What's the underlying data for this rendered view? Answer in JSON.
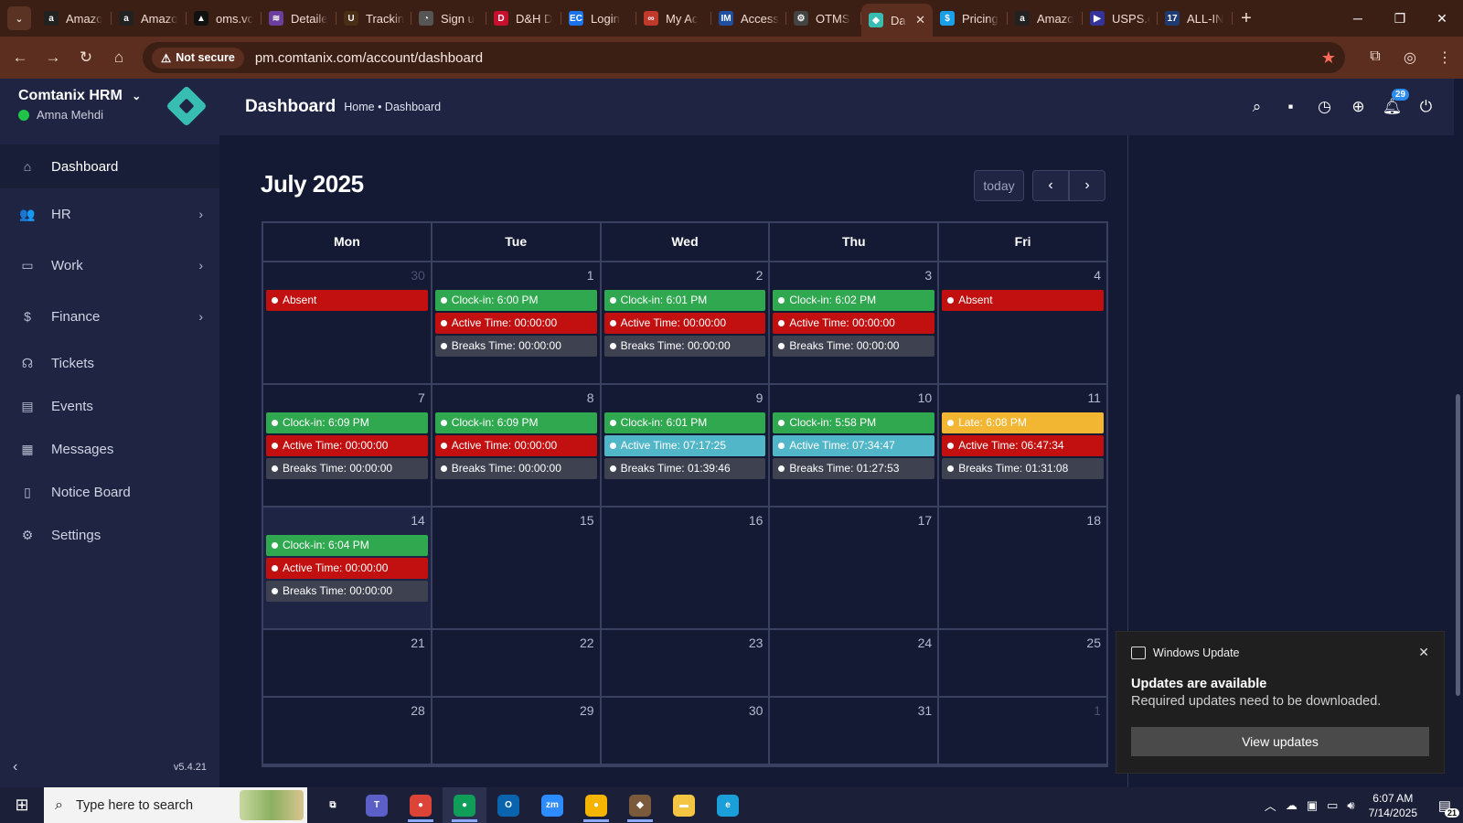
{
  "browser": {
    "tabs": [
      {
        "label": "Amazo",
        "fav": "a",
        "color": "#222222"
      },
      {
        "label": "Amazo",
        "fav": "a",
        "color": "#222222"
      },
      {
        "label": "oms.vc",
        "fav": "▲",
        "color": "#111111"
      },
      {
        "label": "Detaile",
        "fav": "≋",
        "color": "#6b3f9e"
      },
      {
        "label": "Trackin",
        "fav": "U",
        "color": "#4b2e16"
      },
      {
        "label": "Sign u",
        "fav": "◔",
        "color": "#555555"
      },
      {
        "label": "D&H D",
        "fav": "D",
        "color": "#c8102e"
      },
      {
        "label": "Login",
        "fav": "EC",
        "color": "#1a73e8"
      },
      {
        "label": "My Ac",
        "fav": "∞",
        "color": "#c0392b"
      },
      {
        "label": "Access",
        "fav": "IM",
        "color": "#1e4fa3"
      },
      {
        "label": "OTMS",
        "fav": "⚙",
        "color": "#444444"
      },
      {
        "label": "Da",
        "fav": "◆",
        "color": "#38bdb2",
        "active": true
      },
      {
        "label": "Pricing",
        "fav": "$",
        "color": "#1aa0e8"
      },
      {
        "label": "Amazo",
        "fav": "a",
        "color": "#222222"
      },
      {
        "label": "USPS.c",
        "fav": "▶",
        "color": "#333399"
      },
      {
        "label": "ALL-IN",
        "fav": "17",
        "color": "#1e3c72"
      }
    ],
    "close_tab": "✕",
    "new_tab": "+",
    "not_secure": "Not secure",
    "url": "pm.comtanix.com/account/dashboard"
  },
  "sidebar": {
    "org": "Comtanix HRM",
    "user": "Amna Mehdi",
    "items": [
      {
        "label": "Dashboard",
        "icon": "home-icon",
        "glyph": "⌂",
        "active": true,
        "chevron": false
      },
      {
        "label": "HR",
        "icon": "users-icon",
        "glyph": "👥",
        "chevron": true
      },
      {
        "label": "Work",
        "icon": "briefcase-icon",
        "glyph": "▭",
        "chevron": true
      },
      {
        "label": "Finance",
        "icon": "dollar-icon",
        "glyph": "$",
        "chevron": true
      },
      {
        "label": "Tickets",
        "icon": "headset-icon",
        "glyph": "☊",
        "chevron": false
      },
      {
        "label": "Events",
        "icon": "calendar-icon",
        "glyph": "▤",
        "chevron": false
      },
      {
        "label": "Messages",
        "icon": "message-icon",
        "glyph": "▦",
        "chevron": false
      },
      {
        "label": "Notice Board",
        "icon": "clipboard-icon",
        "glyph": "▯",
        "chevron": false
      },
      {
        "label": "Settings",
        "icon": "gear-icon",
        "glyph": "⚙",
        "chevron": false
      }
    ],
    "version": "v5.4.21"
  },
  "header": {
    "title": "Dashboard",
    "breadcrumb": "Home • Dashboard",
    "notification_count": "29"
  },
  "calendar": {
    "month_title": "July 2025",
    "today_label": "today",
    "days": [
      "Mon",
      "Tue",
      "Wed",
      "Thu",
      "Fri"
    ],
    "weeks": [
      {
        "height": 134,
        "cells": [
          {
            "day": "30",
            "other": true,
            "events": [
              {
                "text": "Absent",
                "kind": "red"
              }
            ]
          },
          {
            "day": "1",
            "events": [
              {
                "text": "Clock-in: 6:00 PM",
                "kind": "green"
              },
              {
                "text": "Active Time: 00:00:00",
                "kind": "red"
              },
              {
                "text": "Breaks Time: 00:00:00",
                "kind": "gray"
              }
            ]
          },
          {
            "day": "2",
            "events": [
              {
                "text": "Clock-in: 6:01 PM",
                "kind": "green"
              },
              {
                "text": "Active Time: 00:00:00",
                "kind": "red"
              },
              {
                "text": "Breaks Time: 00:00:00",
                "kind": "gray"
              }
            ]
          },
          {
            "day": "3",
            "events": [
              {
                "text": "Clock-in: 6:02 PM",
                "kind": "green"
              },
              {
                "text": "Active Time: 00:00:00",
                "kind": "red"
              },
              {
                "text": "Breaks Time: 00:00:00",
                "kind": "gray"
              }
            ]
          },
          {
            "day": "4",
            "events": [
              {
                "text": "Absent",
                "kind": "red"
              }
            ]
          }
        ]
      },
      {
        "height": 134,
        "cells": [
          {
            "day": "7",
            "events": [
              {
                "text": "Clock-in: 6:09 PM",
                "kind": "green"
              },
              {
                "text": "Active Time: 00:00:00",
                "kind": "red"
              },
              {
                "text": "Breaks Time: 00:00:00",
                "kind": "gray"
              }
            ]
          },
          {
            "day": "8",
            "events": [
              {
                "text": "Clock-in: 6:09 PM",
                "kind": "green"
              },
              {
                "text": "Active Time: 00:00:00",
                "kind": "red"
              },
              {
                "text": "Breaks Time: 00:00:00",
                "kind": "gray"
              }
            ]
          },
          {
            "day": "9",
            "events": [
              {
                "text": "Clock-in: 6:01 PM",
                "kind": "green"
              },
              {
                "text": "Active Time: 07:17:25",
                "kind": "teal"
              },
              {
                "text": "Breaks Time: 01:39:46",
                "kind": "gray"
              }
            ]
          },
          {
            "day": "10",
            "events": [
              {
                "text": "Clock-in: 5:58 PM",
                "kind": "green"
              },
              {
                "text": "Active Time: 07:34:47",
                "kind": "teal"
              },
              {
                "text": "Breaks Time: 01:27:53",
                "kind": "gray"
              }
            ]
          },
          {
            "day": "11",
            "events": [
              {
                "text": "Late: 6:08 PM",
                "kind": "yellow"
              },
              {
                "text": "Active Time: 06:47:34",
                "kind": "red"
              },
              {
                "text": "Breaks Time: 01:31:08",
                "kind": "gray"
              }
            ]
          }
        ]
      },
      {
        "height": 134,
        "cells": [
          {
            "day": "14",
            "today": true,
            "events": [
              {
                "text": "Clock-in: 6:04 PM",
                "kind": "green"
              },
              {
                "text": "Active Time: 00:00:00",
                "kind": "red"
              },
              {
                "text": "Breaks Time: 00:00:00",
                "kind": "gray"
              }
            ]
          },
          {
            "day": "15",
            "events": []
          },
          {
            "day": "16",
            "events": []
          },
          {
            "day": "17",
            "events": []
          },
          {
            "day": "18",
            "events": []
          }
        ]
      },
      {
        "height": 74,
        "cells": [
          {
            "day": "21",
            "events": []
          },
          {
            "day": "22",
            "events": []
          },
          {
            "day": "23",
            "events": []
          },
          {
            "day": "24",
            "events": []
          },
          {
            "day": "25",
            "events": []
          }
        ]
      },
      {
        "height": 74,
        "cells": [
          {
            "day": "28",
            "events": []
          },
          {
            "day": "29",
            "events": []
          },
          {
            "day": "30",
            "events": []
          },
          {
            "day": "31",
            "events": []
          },
          {
            "day": "1",
            "other": true,
            "events": []
          }
        ]
      }
    ],
    "colors": {
      "green": "#2fa84f",
      "red": "#c20f0f",
      "gray": "#3e4150",
      "teal": "#51b6c7",
      "yellow": "#f3b632"
    }
  },
  "toast": {
    "app": "Windows Update",
    "title": "Updates are available",
    "body": "Required updates need to be downloaded.",
    "button": "View updates"
  },
  "taskbar": {
    "search_placeholder": "Type here to search",
    "time": "6:07 AM",
    "date": "7/14/2025",
    "notification_count": "21",
    "apps": [
      {
        "name": "task-view-icon",
        "glyph": "⧉",
        "bg": "transparent"
      },
      {
        "name": "teams-icon",
        "glyph": "T",
        "bg": "#5b5fc7"
      },
      {
        "name": "chrome-icon",
        "glyph": "●",
        "bg": "#db4437",
        "on": true
      },
      {
        "name": "chrome-profile-icon",
        "glyph": "●",
        "bg": "#0f9d58",
        "on": true,
        "sel": true
      },
      {
        "name": "outlook-icon",
        "glyph": "O",
        "bg": "#0a64ad"
      },
      {
        "name": "zoom-icon",
        "glyph": "zm",
        "bg": "#2d8cff"
      },
      {
        "name": "chrome-alt-icon",
        "glyph": "●",
        "bg": "#f4b400",
        "on": true
      },
      {
        "name": "comtanix-app-icon",
        "glyph": "◆",
        "bg": "#7a5a3a",
        "on": true
      },
      {
        "name": "file-explorer-icon",
        "glyph": "▬",
        "bg": "#f4c542"
      },
      {
        "name": "edge-icon",
        "glyph": "e",
        "bg": "#1a9fd8"
      }
    ]
  }
}
